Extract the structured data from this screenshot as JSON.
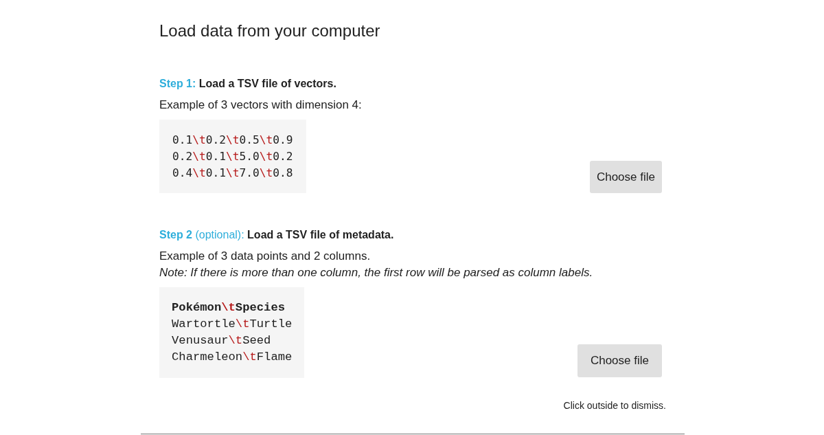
{
  "dialog": {
    "title": "Load data from your computer",
    "steps": [
      {
        "step_label": "Step 1:",
        "instruction": "Load a TSV file of vectors.",
        "description": "Example of 3 vectors with dimension 4:",
        "example_lines": [
          {
            "header": false,
            "segments": [
              {
                "kind": "value",
                "text": "0.1"
              },
              {
                "kind": "tab",
                "text": "\\t"
              },
              {
                "kind": "value",
                "text": "0.2"
              },
              {
                "kind": "tab",
                "text": "\\t"
              },
              {
                "kind": "value",
                "text": "0.5"
              },
              {
                "kind": "tab",
                "text": "\\t"
              },
              {
                "kind": "value",
                "text": "0.9"
              }
            ]
          },
          {
            "header": false,
            "segments": [
              {
                "kind": "value",
                "text": "0.2"
              },
              {
                "kind": "tab",
                "text": "\\t"
              },
              {
                "kind": "value",
                "text": "0.1"
              },
              {
                "kind": "tab",
                "text": "\\t"
              },
              {
                "kind": "value",
                "text": "5.0"
              },
              {
                "kind": "tab",
                "text": "\\t"
              },
              {
                "kind": "value",
                "text": "0.2"
              }
            ]
          },
          {
            "header": false,
            "segments": [
              {
                "kind": "value",
                "text": "0.4"
              },
              {
                "kind": "tab",
                "text": "\\t"
              },
              {
                "kind": "value",
                "text": "0.1"
              },
              {
                "kind": "tab",
                "text": "\\t"
              },
              {
                "kind": "value",
                "text": "7.0"
              },
              {
                "kind": "tab",
                "text": "\\t"
              },
              {
                "kind": "value",
                "text": "0.8"
              }
            ]
          }
        ],
        "button": "Choose file"
      },
      {
        "step_label": "Step 2",
        "optional_label": "(optional):",
        "instruction": "Load a TSV file of metadata.",
        "description": "Example of 3 data points and 2 columns.",
        "note": "Note: If there is more than one column, the first row will be parsed as column labels.",
        "example_lines": [
          {
            "header": true,
            "segments": [
              {
                "kind": "value",
                "text": "Pokémon"
              },
              {
                "kind": "tab",
                "text": "\\t"
              },
              {
                "kind": "value",
                "text": "Species"
              }
            ]
          },
          {
            "header": false,
            "segments": [
              {
                "kind": "value",
                "text": "Wartortle"
              },
              {
                "kind": "tab",
                "text": "\\t"
              },
              {
                "kind": "value",
                "text": "Turtle"
              }
            ]
          },
          {
            "header": false,
            "segments": [
              {
                "kind": "value",
                "text": "Venusaur"
              },
              {
                "kind": "tab",
                "text": "\\t"
              },
              {
                "kind": "value",
                "text": "Seed"
              }
            ]
          },
          {
            "header": false,
            "segments": [
              {
                "kind": "value",
                "text": "Charmeleon"
              },
              {
                "kind": "tab",
                "text": "\\t"
              },
              {
                "kind": "value",
                "text": "Flame"
              }
            ]
          }
        ],
        "button": "Choose file"
      }
    ],
    "dismiss_hint": "Click outside to dismiss."
  }
}
